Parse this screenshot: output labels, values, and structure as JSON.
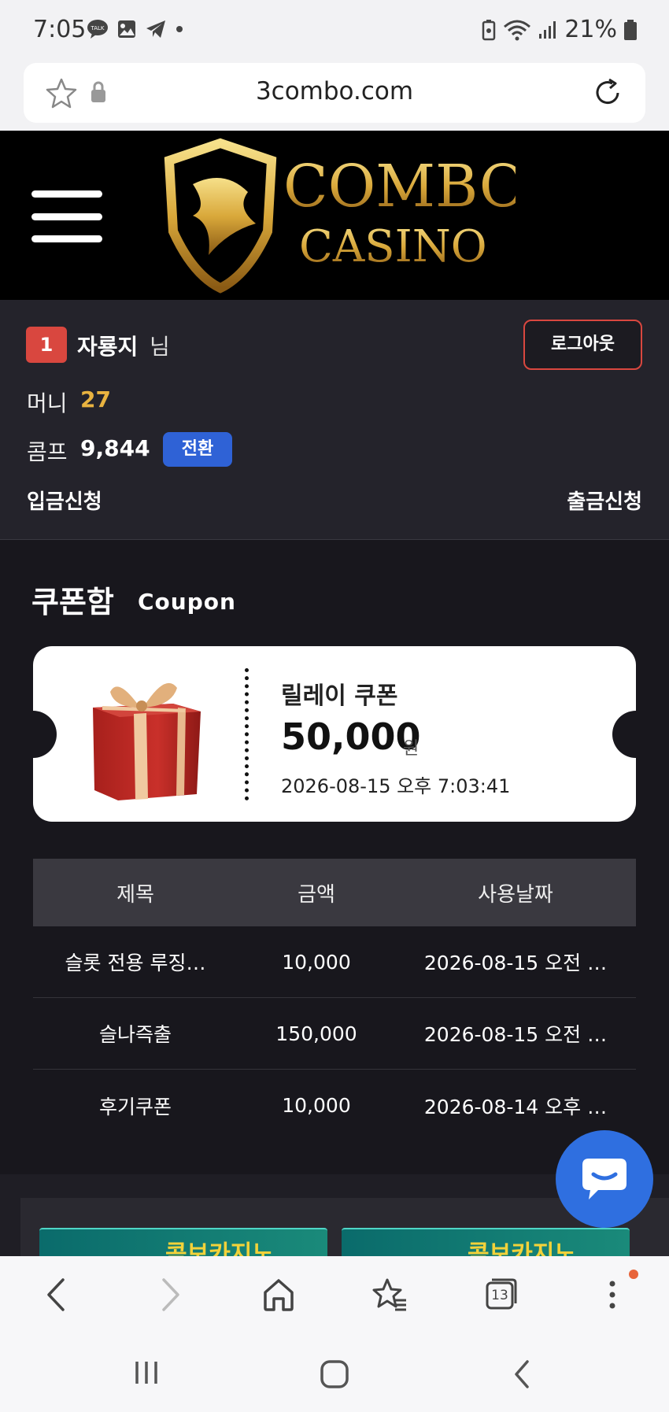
{
  "status_bar": {
    "time": "7:05",
    "battery": "21%"
  },
  "browser": {
    "url": "3combo.com",
    "tab_count": "13"
  },
  "site": {
    "logo_line1": "COMBO",
    "logo_line2": "CASINO"
  },
  "user": {
    "level": "1",
    "name": "자룡지",
    "suffix": "님",
    "logout_label": "로그아웃",
    "money_label": "머니",
    "money_value": "27",
    "comp_label": "콤프",
    "comp_value": "9,844",
    "convert_label": "전환",
    "deposit_label": "입금신청",
    "withdraw_label": "출금신청"
  },
  "coupon_section": {
    "title": "쿠폰함",
    "subtitle": "Coupon",
    "card": {
      "name": "릴레이 쿠폰",
      "amount": "50,000",
      "unit": "원",
      "date": "2026-08-15 오후 7:03:41"
    },
    "table": {
      "headers": [
        "제목",
        "금액",
        "사용날짜"
      ],
      "rows": [
        [
          "슬롯 전용 루징…",
          "10,000",
          "2026-08-15 오전 …"
        ],
        [
          "슬나즉출",
          "150,000",
          "2026-08-15 오전 …"
        ],
        [
          "후기쿠폰",
          "10,000",
          "2026-08-14 오후 …"
        ]
      ]
    }
  },
  "banners": {
    "left_text": "콤보카지노",
    "right_text": "콤보카지노"
  },
  "colors": {
    "accent_red": "#d9473f",
    "money_gold": "#e9b340",
    "convert_blue": "#2f62d6",
    "chat_blue": "#2f6fe0"
  }
}
